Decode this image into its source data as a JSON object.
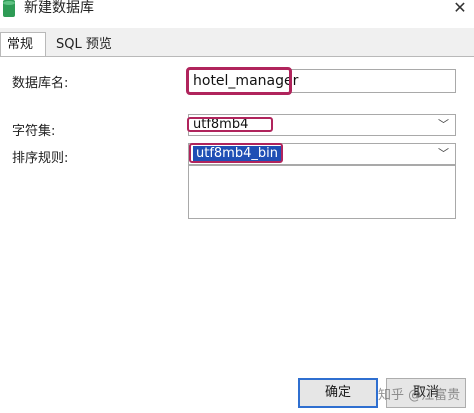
{
  "window": {
    "title": "新建数据库"
  },
  "tabs": [
    {
      "label": "常规"
    },
    {
      "label": "SQL 预览"
    }
  ],
  "form": {
    "db_name": {
      "label": "数据库名:",
      "value": "hotel_manager"
    },
    "charset": {
      "label": "字符集:",
      "value": "utf8mb4"
    },
    "collation": {
      "label": "排序规则:",
      "value": "utf8mb4_bin"
    }
  },
  "buttons": {
    "ok": "确定",
    "cancel": "取消"
  },
  "watermark": "知乎 @江富贵",
  "colors": {
    "highlight": "#b0245c",
    "selection": "#1f4fb5",
    "focus": "#2f6fd0",
    "app_icon": "#2e9b55"
  }
}
